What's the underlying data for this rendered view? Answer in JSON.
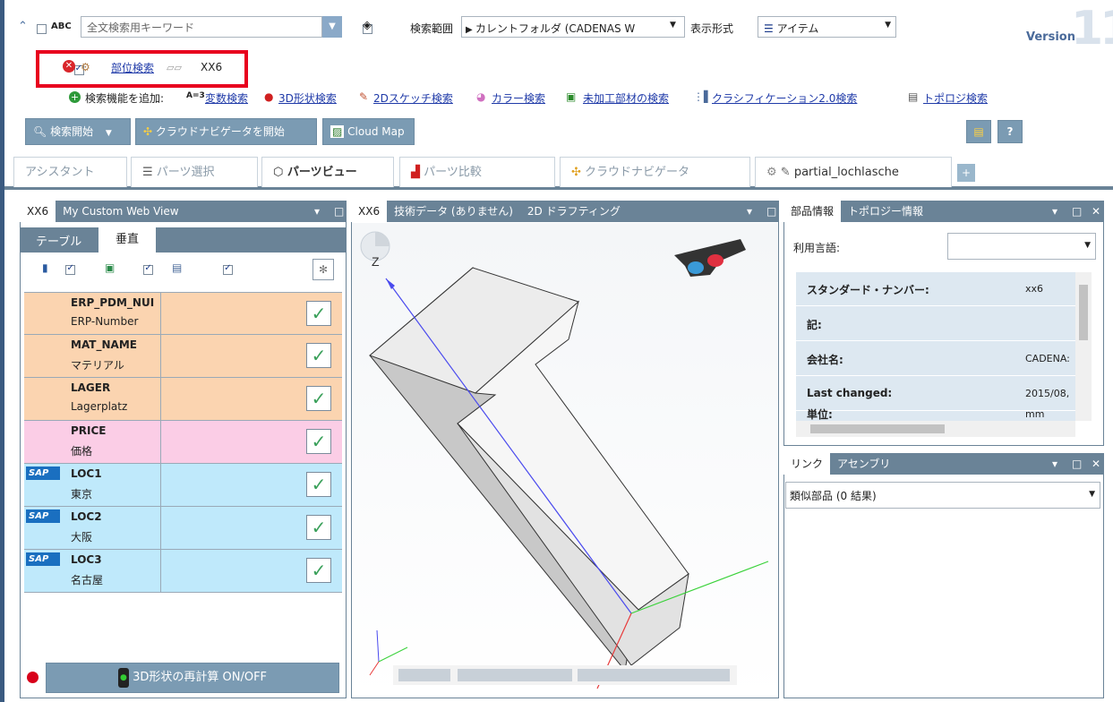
{
  "toolbar": {
    "search_placeholder": "全文検索用キーワード",
    "abc_label": "ABC",
    "scope_label": "検索範囲",
    "scope_value": "カレントフォルダ (CADENAS W",
    "format_label": "表示形式",
    "format_value": "アイテム",
    "version_label": "Version",
    "version_number": "11"
  },
  "partsearch": {
    "link": "部位検索",
    "value": "XX6"
  },
  "addsearch": {
    "label": "検索機能を追加:",
    "var_prefix": "A=3",
    "items": [
      "変数検索",
      "3D形状検索",
      "2Dスケッチ検索",
      "カラー検索",
      "未加工部材の検索",
      "クラシフィケーション2.0検索",
      "トポロジ検索"
    ]
  },
  "actions": {
    "start_search": "検索開始",
    "cloud_navigator": "クラウドナビゲータを開始",
    "cloud_map": "Cloud Map"
  },
  "tabs": [
    "アシスタント",
    "パーツ選択",
    "パーツビュー",
    "パーツ比較",
    "クラウドナビゲータ",
    "partial_lochlasche"
  ],
  "left_panel": {
    "tabs": [
      "XX6",
      "My Custom Web View"
    ],
    "subtabs": [
      "テーブル",
      "垂直"
    ],
    "rows": [
      {
        "name": "ERP_PDM_NUI",
        "label": "ERP-Number"
      },
      {
        "name": "MAT_NAME",
        "label": "マテリアル"
      },
      {
        "name": "LAGER",
        "label": "Lagerplatz"
      },
      {
        "name": "PRICE",
        "label": "価格"
      },
      {
        "name": "LOC1",
        "label": "東京",
        "sap": "SAP"
      },
      {
        "name": "LOC2",
        "label": "大阪",
        "sap": "SAP"
      },
      {
        "name": "LOC3",
        "label": "名古屋",
        "sap": "SAP"
      }
    ],
    "recalc_button": "3D形状の再計算 ON/OFF"
  },
  "viewer": {
    "tabs": [
      "XX6",
      "技術データ (ありません)",
      "2D ドラフティング"
    ],
    "axis_z": "Z"
  },
  "info_panel": {
    "tabs": [
      "部品情報",
      "トポロジー情報"
    ],
    "language_label": "利用言語:",
    "rows": [
      {
        "key": "スタンダード・ナンバー:",
        "value": "xx6"
      },
      {
        "key": "記:",
        "value": ""
      },
      {
        "key": "会社名:",
        "value": "CADENA:"
      },
      {
        "key": "Last changed:",
        "value": "2015/08,"
      },
      {
        "key": "単位:",
        "value": "mm"
      }
    ]
  },
  "link_panel": {
    "tabs": [
      "リンク",
      "アセンブリ"
    ],
    "similar": "類似部品 (0 結果)"
  },
  "colors": {
    "orange_row": "#fbd4b0",
    "pink_row": "#fbcde6",
    "blue_row": "#bfe9fb",
    "panel_header": "#6a8397"
  }
}
